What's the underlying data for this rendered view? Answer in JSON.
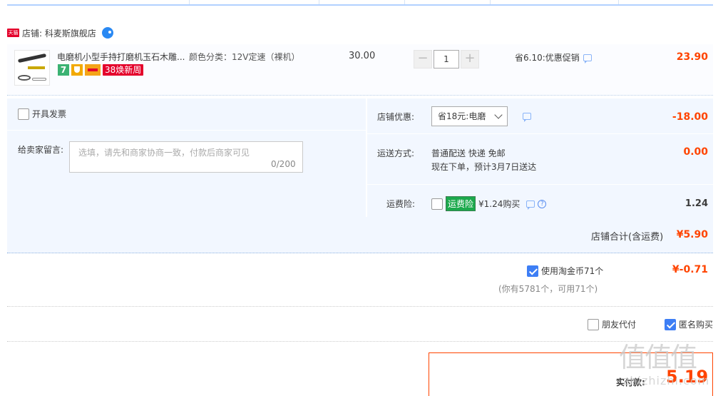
{
  "shop": {
    "badge": "天猫",
    "label": "店铺: 科麦斯旗舰店"
  },
  "item": {
    "title": "电磨机小型手持打磨机玉石木雕...",
    "sku": "颜色分类：12V定速（裸机）",
    "price": "30.00",
    "quantity": "1",
    "badge_7": "7",
    "badge_38": "38焕新周",
    "promo": "省6.10:优惠促销",
    "subtotal": "23.90"
  },
  "order": {
    "invoice_label": "开具发票",
    "message_label": "给卖家留言:",
    "message_placeholder": "选填，请先和商家协商一致，付款后商家可见",
    "message_count": "0/200",
    "shop_discount_label": "店铺优惠:",
    "shop_discount_selected": "省18元:电磨",
    "shop_discount_value": "-18.00",
    "shipping_label": "运送方式:",
    "shipping_method": "普通配送 快递 免邮",
    "shipping_eta": "现在下单，预计3月7日送达",
    "shipping_value": "0.00",
    "insurance_label": "运费险:",
    "insurance_badge": "运费险",
    "insurance_price": "¥1.24购买",
    "insurance_value": "1.24",
    "shop_total_label": "店铺合计(含运费)",
    "shop_total_value": "¥5.90"
  },
  "coins": {
    "label": "使用淘金币71个",
    "sub": "(你有5781个，可用71个)",
    "value": "¥-0.71",
    "checked": true
  },
  "options": {
    "friend_pay": "朋友代付",
    "anonymous": "匿名购买"
  },
  "payment": {
    "label": "实付款:",
    "value": "5.19"
  },
  "watermark": {
    "main": "值值值",
    "sub": "zhizhizhi.com"
  },
  "colors": {
    "accent_red": "#ff4400",
    "panel_bg": "#f2f7ff",
    "checkbox_blue": "#3d7ef5",
    "insurance_green": "#1ca94c"
  }
}
